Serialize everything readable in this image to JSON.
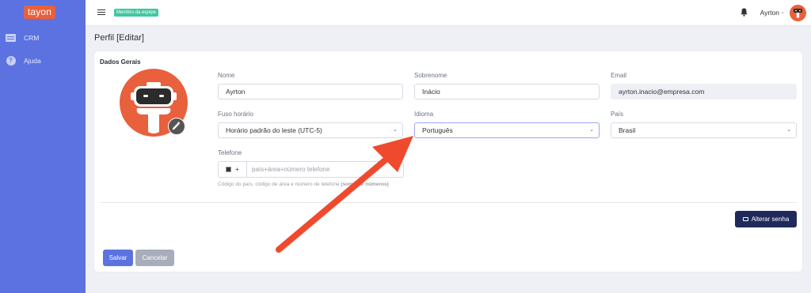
{
  "sidebar": {
    "logo": "tayon",
    "items": [
      {
        "label": "CRM",
        "icon": "crm-card-icon"
      },
      {
        "label": "Ajuda",
        "icon": "help-icon"
      }
    ]
  },
  "topbar": {
    "team_badge": "Membro da equipe",
    "user_name": "Ayrton",
    "caret": "⌄"
  },
  "page": {
    "title": "Perfil [Editar]"
  },
  "form": {
    "section_title": "Dados Gerais",
    "nome": {
      "label": "Nome",
      "value": "Ayrton"
    },
    "sobrenome": {
      "label": "Sobrenome",
      "value": "Inácio"
    },
    "email": {
      "label": "Email",
      "value": "ayrton.inacio@empresa.com"
    },
    "fuso": {
      "label": "Fuso horário",
      "value": "Horário padrão do leste (UTC-5)"
    },
    "idioma": {
      "label": "Idioma",
      "value": "Português"
    },
    "pais": {
      "label": "País",
      "value": "Brasil"
    },
    "telefone": {
      "label": "Telefone",
      "prefix": "+",
      "placeholder": "país+área+número telefone",
      "help_prefix": "Código do país, código de área e número de telefone",
      "help_bold": "(somente números)"
    }
  },
  "buttons": {
    "change_password": "Alterar senha",
    "save": "Salvar",
    "cancel": "Cancelar"
  },
  "colors": {
    "sidebar": "#5b72e0",
    "brand": "#e8603c",
    "badge": "#43c7a0",
    "annotation_arrow": "#ef4a2e"
  }
}
